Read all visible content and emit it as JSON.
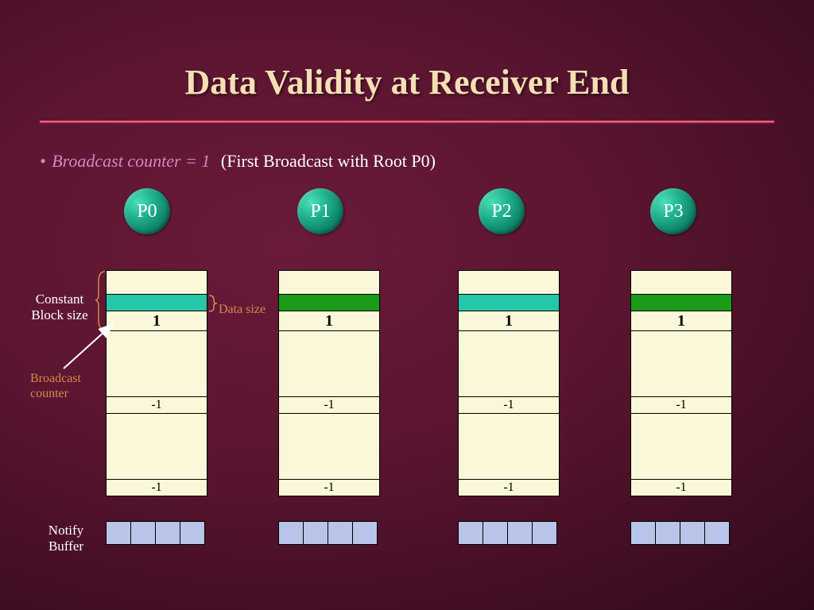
{
  "title": "Data Validity at Receiver End",
  "subtitle_emph": "Broadcast counter = 1",
  "subtitle_rest": "(First Broadcast with Root P0)",
  "labels": {
    "constant_block_size_l1": "Constant",
    "constant_block_size_l2": "Block size",
    "data_size": "Data size",
    "broadcast_counter_l1": "Broadcast",
    "broadcast_counter_l2": "counter",
    "notify_buffer_l1": "Notify",
    "notify_buffer_l2": "Buffer"
  },
  "processes": [
    "P0",
    "P1",
    "P2",
    "P3"
  ],
  "chart_data": {
    "type": "table",
    "title": "Data Validity at Receiver End",
    "columns": [
      "P0",
      "P1",
      "P2",
      "P3"
    ],
    "data_strip_color": [
      "teal",
      "green",
      "teal",
      "green"
    ],
    "rows": [
      {
        "name": "broadcast_counter",
        "values": [
          1,
          1,
          1,
          1
        ]
      },
      {
        "name": "slot2_counter",
        "values": [
          -1,
          -1,
          -1,
          -1
        ]
      },
      {
        "name": "slot3_counter",
        "values": [
          -1,
          -1,
          -1,
          -1
        ]
      }
    ],
    "notify_buffer_cells_per_process": 4,
    "annotations": {
      "constant_block_size": "height of top empty + data strip",
      "data_size": "height of colored data strip",
      "broadcast_counter_points_to": "counter row value 1"
    }
  }
}
